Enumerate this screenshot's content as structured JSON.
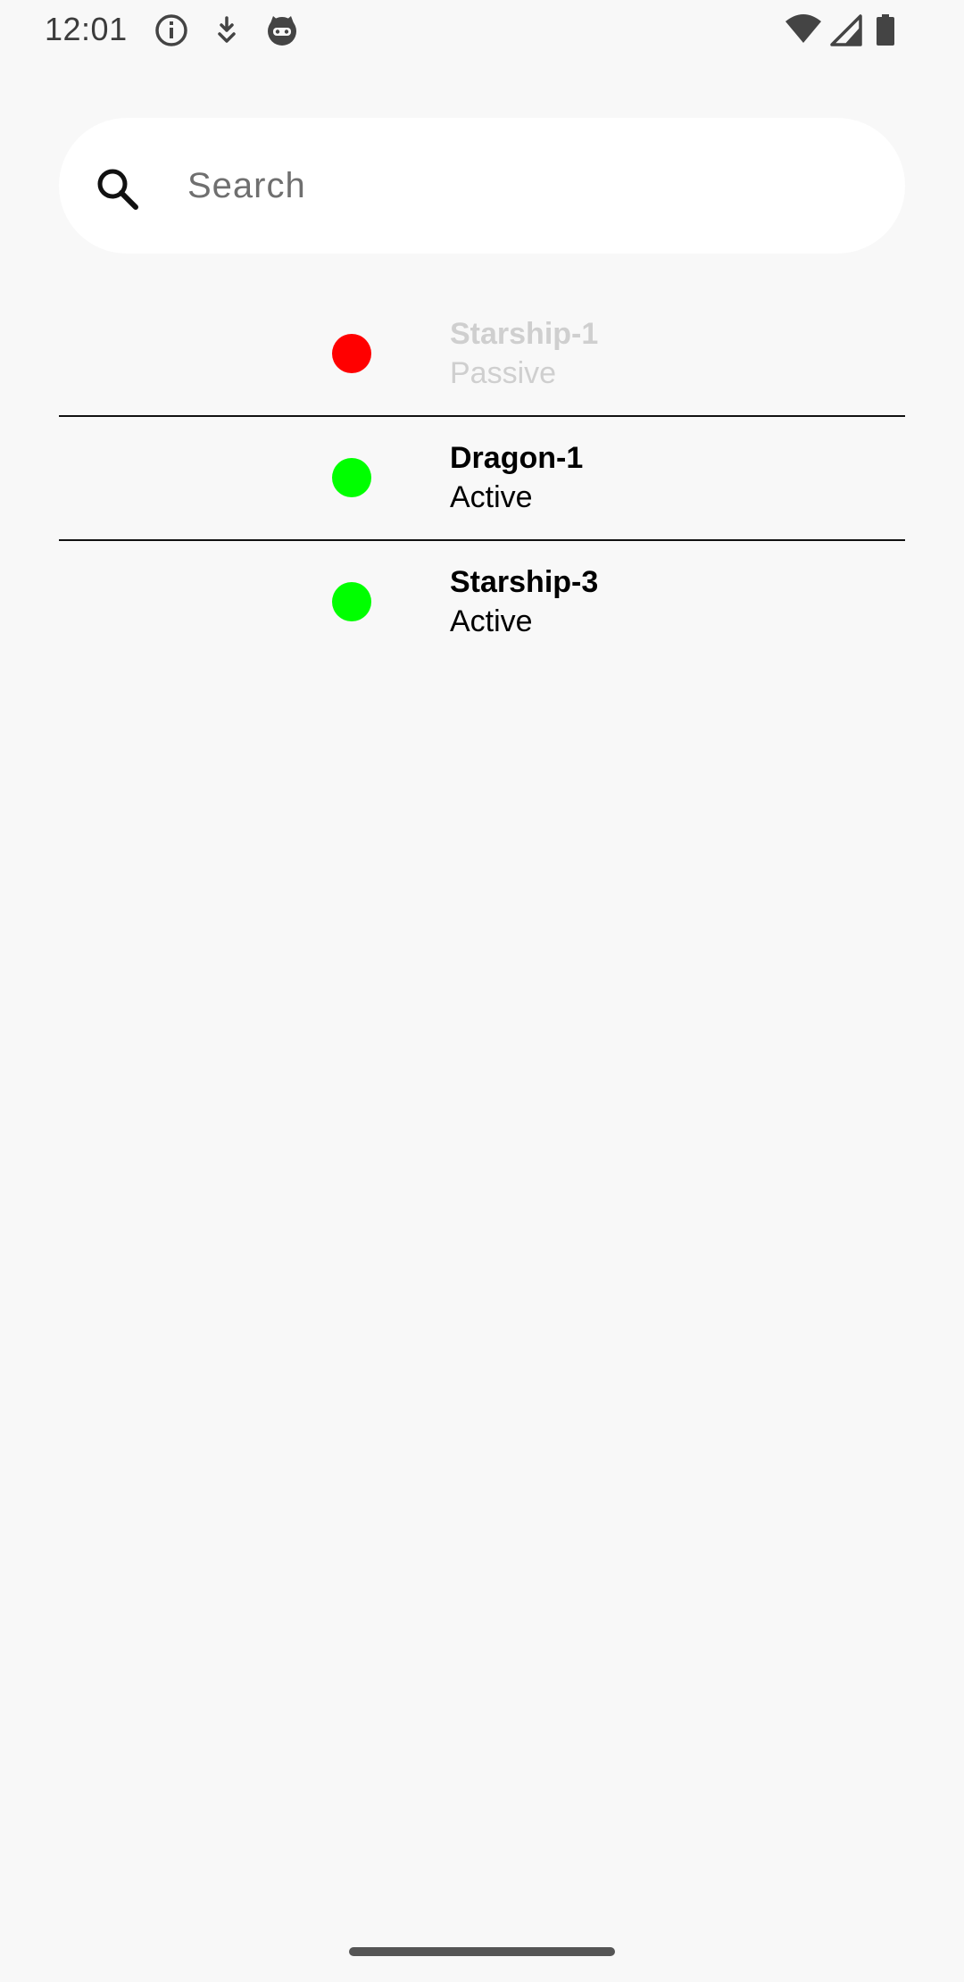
{
  "status_bar": {
    "time": "12:01",
    "left_icons": [
      "info-icon",
      "download-arrow-icon",
      "cat-face-icon"
    ],
    "right_icons": [
      "wifi-icon",
      "cell-signal-icon",
      "battery-icon"
    ]
  },
  "search": {
    "placeholder": "Search",
    "value": "",
    "icon": "search-icon"
  },
  "ships": [
    {
      "name": "Starship-1",
      "status": "Passive",
      "dot_color": "#ff0000",
      "dimmed": true
    },
    {
      "name": "Dragon-1",
      "status": "Active",
      "dot_color": "#00ff00",
      "dimmed": false
    },
    {
      "name": "Starship-3",
      "status": "Active",
      "dot_color": "#00ff00",
      "dimmed": false
    }
  ],
  "colors": {
    "background": "#f8f8f8",
    "passive_dot": "#ff0000",
    "active_dot": "#00ff00",
    "dimmed_text": "#cfcfcf"
  }
}
